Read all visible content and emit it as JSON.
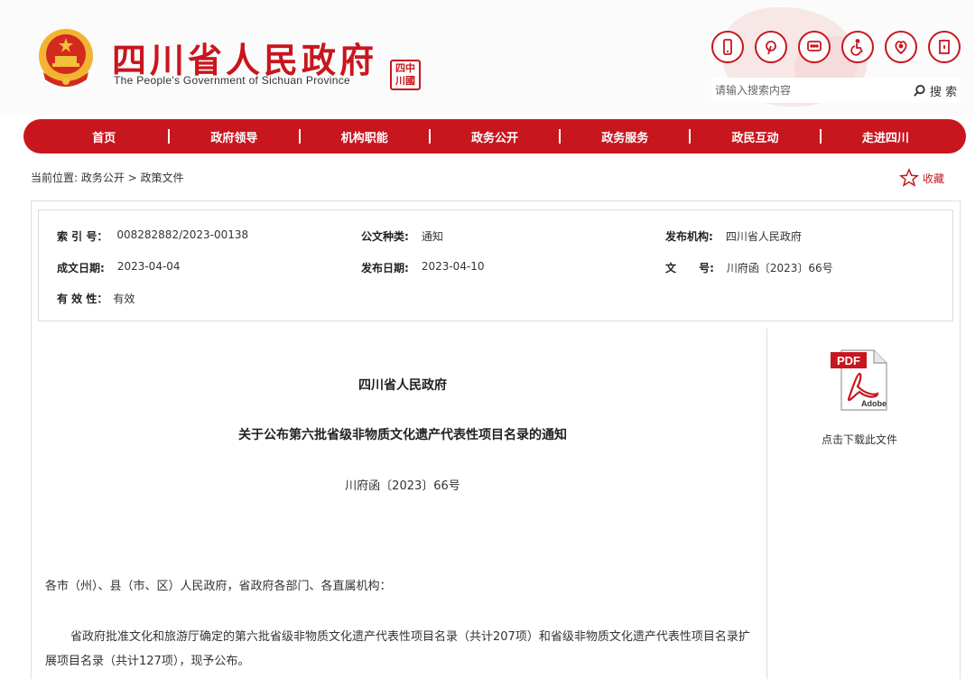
{
  "header": {
    "site_title": "四川省人民政府",
    "site_subtitle": "The People's Government of Sichuan Province",
    "seal_text": [
      "四",
      "中",
      "川",
      "國"
    ],
    "tools": [
      {
        "name": "mobile-icon"
      },
      {
        "name": "weibo-icon"
      },
      {
        "name": "message-icon"
      },
      {
        "name": "accessibility-icon"
      },
      {
        "name": "elderly-care-icon"
      },
      {
        "name": "exit-icon"
      }
    ],
    "search": {
      "placeholder": "请输入搜索内容",
      "button_label": "搜 索"
    }
  },
  "nav": {
    "items": [
      "首页",
      "政府领导",
      "机构职能",
      "政务公开",
      "政务服务",
      "政民互动",
      "走进四川"
    ]
  },
  "breadcrumb": "当前位置: 政务公开 > 政策文件",
  "favorite_label": "收藏",
  "meta": {
    "index_label": "索 引 号：",
    "index_value": "008282882/2023-00138",
    "type_label": "公文种类:",
    "type_value": "通知",
    "publisher_label": "发布机构:",
    "publisher_value": "四川省人民政府",
    "created_label": "成文日期:",
    "created_value": "2023-04-04",
    "published_label": "发布日期:",
    "published_value": "2023-04-10",
    "doc_no_label": "文      号:",
    "doc_no_value": "川府函〔2023〕66号",
    "validity_label": "有 效 性：",
    "validity_value": "有效"
  },
  "document": {
    "org": "四川省人民政府",
    "title": "关于公布第六批省级非物质文化遗产代表性项目名录的通知",
    "number": "川府函〔2023〕66号",
    "address": "各市（州）、县（市、区）人民政府，省政府各部门、各直属机构：",
    "paragraph": "省政府批准文化和旅游厅确定的第六批省级非物质文化遗产代表性项目名录（共计207项）和省级非物质文化遗产代表性项目名录扩展项目名录（共计127项），现予公布。"
  },
  "download": {
    "pdf_badge": "PDF",
    "adobe_text": "Adobe",
    "label": "点击下载此文件"
  },
  "colors": {
    "brand_red": "#c8161e"
  }
}
